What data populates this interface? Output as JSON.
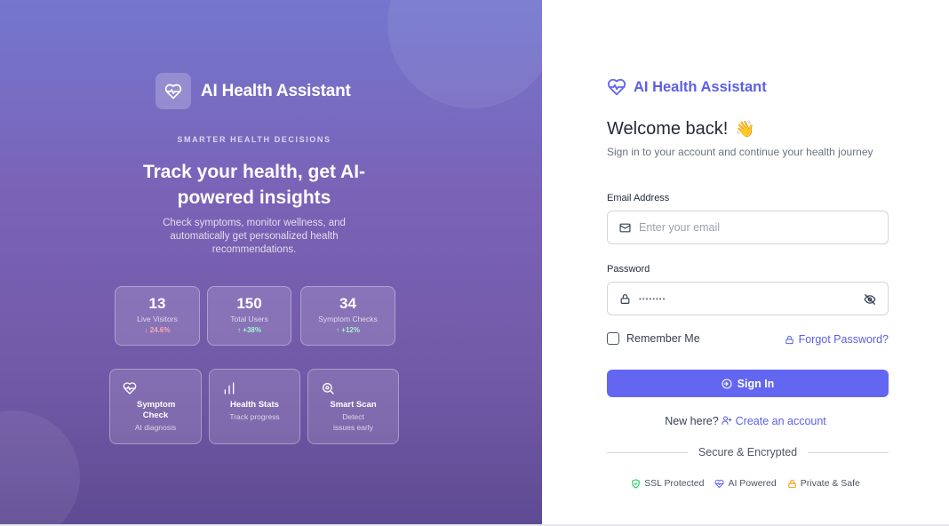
{
  "colors": {
    "accent": "#6366f1",
    "brand_text": "#5b5fe6",
    "hero_gradient_top": "#7477cf",
    "hero_gradient_bottom": "#5e4b93",
    "delta_down": "#f7a9b7",
    "delta_up": "#a7f3d0",
    "ssl_green": "#22c55e",
    "lock_orange": "#f59e0b"
  },
  "hero": {
    "brand_name": "AI Health Assistant",
    "logo_icon": "heart-pulse-icon",
    "eyebrow": "SMARTER HEALTH DECISIONS",
    "headline": "Track your health, get AI-powered insights",
    "subtext": "Check symptoms, monitor wellness, and automatically get personalized health recommendations.",
    "stats": [
      {
        "value": "13",
        "label": "Live Visitors",
        "delta": "↓ 24.6%",
        "trend": "down"
      },
      {
        "value": "150",
        "label": "Total Users",
        "delta": "↑ +38%",
        "trend": "up"
      },
      {
        "value": "34",
        "label": "Symptom Checks",
        "delta": "↑ +12%",
        "trend": "up"
      }
    ],
    "features": [
      {
        "icon": "heart-pulse-icon",
        "title": "Symptom Check",
        "desc": "AI diagnosis"
      },
      {
        "icon": "bar-chart-icon",
        "title": "Health Stats",
        "desc": "Track progress"
      },
      {
        "icon": "scan-search-icon",
        "title": "Smart Scan",
        "desc": "Detect issues early"
      }
    ]
  },
  "form": {
    "brand_name": "AI Health Assistant",
    "brand_icon": "heart-pulse-icon",
    "welcome": "Welcome back!",
    "welcome_emoji": "👋",
    "subtitle": "Sign in to your account and continue your health journey",
    "email": {
      "label": "Email Address",
      "placeholder": "Enter your email",
      "icon": "mail-icon"
    },
    "password": {
      "label": "Password",
      "value": "••••••••",
      "icon": "lock-icon",
      "toggle_icon": "eye-off-icon"
    },
    "remember_label": "Remember Me",
    "forgot_label": "Forgot Password?",
    "signin_label": "Sign In",
    "new_here": "New here?",
    "create_account": "Create an account",
    "secure_label": "Secure & Encrypted",
    "badges": [
      {
        "icon": "shield-check-icon",
        "label": "SSL Protected"
      },
      {
        "icon": "heart-pulse-icon",
        "label": "AI Powered"
      },
      {
        "icon": "lock-icon",
        "label": "Private & Safe"
      }
    ]
  }
}
